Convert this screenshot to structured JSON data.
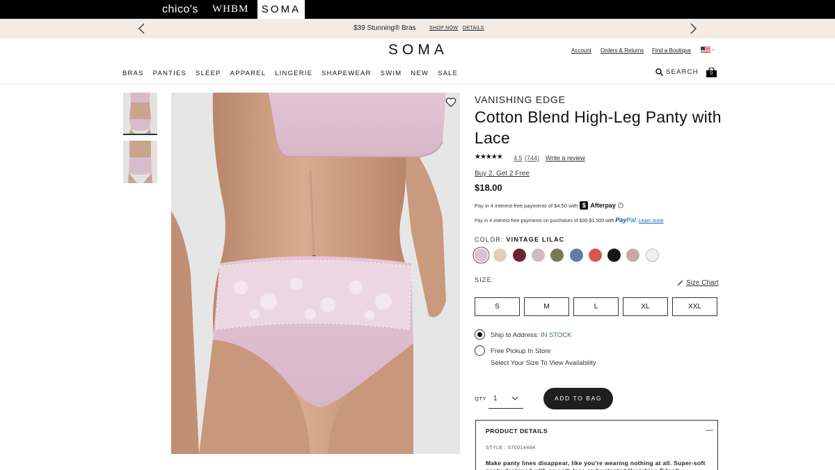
{
  "brand_bar": {
    "brands": [
      "chico's",
      "WHBM",
      "SOMA"
    ],
    "active": "SOMA"
  },
  "promo_bar": {
    "text": "$39 Stunning® Bras",
    "shop_now": "SHOP NOW",
    "details": "DETAILS",
    "bg_color": "#f3ebe4"
  },
  "header": {
    "logo": "SOMA",
    "account": "Account",
    "orders_returns": "Orders & Returns",
    "find_boutique": "Find a Boutique",
    "search_label": "SEARCH",
    "bag_count": "0"
  },
  "nav": {
    "items": [
      "BRAS",
      "PANTIES",
      "SLEEP",
      "APPAREL",
      "LINGERIE",
      "SHAPEWEAR",
      "SWIM",
      "NEW",
      "SALE"
    ]
  },
  "product": {
    "brand_line": "VANISHING EDGE",
    "title": "Cotton Blend High-Leg Panty with Lace",
    "stars": "★★★★★",
    "rating": "4.5",
    "review_count": "(744)",
    "write_review": "Write a review",
    "promo": "Buy 2, Get 2 Free",
    "price": "$18.00",
    "afterpay_text": "Pay in 4 interest-free payments of $4.50 with",
    "afterpay_name": "Afterpay",
    "paypal_text": "Pay in 4 interest-free payments on purchases of $30-$1,500 with",
    "paypal_name_a": "Pay",
    "paypal_name_b": "Pal",
    "paypal_link": "Learn more",
    "color_label": "COLOR:",
    "color_value": "VINTAGE LILAC",
    "swatches": [
      "#d9c2d2",
      "#e3cdb5",
      "#6e2436",
      "#cfbcc1",
      "#7a7a52",
      "#5f7ea6",
      "#d8574f",
      "#161616",
      "#c3a8a5",
      "#f1efec"
    ],
    "size_label": "SIZE:",
    "size_chart": "Size Chart",
    "sizes": [
      "S",
      "M",
      "L",
      "XL",
      "XXL"
    ],
    "ship_label": "Ship to Address:",
    "ship_status": "IN STOCK",
    "pickup_label": "Free Pickup In Store",
    "pickup_note": "Select Your Size To View Availability",
    "qty_label": "QTY",
    "qty_value": "1",
    "add_to_bag": "ADD TO BAG",
    "details_title": "PRODUCT DETAILS",
    "details_toggle": "—",
    "style": "STYLE : 570014484",
    "description": "Make panty lines disappear, like you're wearing nothing at all. Super-soft panty designed with smooth lace and patented Vanishing Edge®"
  }
}
